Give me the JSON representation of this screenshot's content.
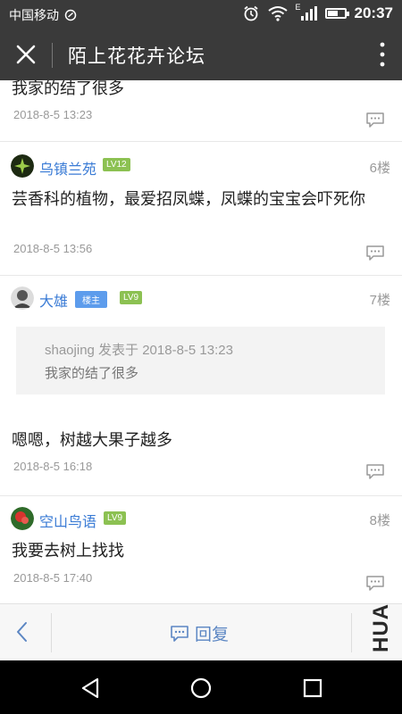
{
  "status_bar": {
    "carrier": "中国移动",
    "network_badge": "E",
    "time": "20:37",
    "battery_level": 0.6,
    "icons": [
      "notification-icon",
      "alarm-icon",
      "wifi-icon",
      "signal-icon",
      "battery-icon"
    ]
  },
  "title_bar": {
    "title": "陌上花花卉论坛",
    "icons": [
      "close-icon",
      "more-vert-icon"
    ]
  },
  "posts": [
    {
      "text": "我家的结了很多",
      "date": "2018-8-5 13:23"
    },
    {
      "user": "乌镇兰苑",
      "level": "LV12",
      "floor": "6楼",
      "text": "芸香科的植物，最爱招凤蝶，凤蝶的宝宝会吓死你",
      "date": "2018-8-5 13:56"
    },
    {
      "user": "大雄",
      "host_badge": "楼主",
      "level": "LV9",
      "floor": "7楼",
      "quote_header": "shaojing 发表于 2018-8-5 13:23",
      "quote_text": "我家的结了很多",
      "text": "嗯嗯，树越大果子越多",
      "date": "2018-8-5 16:18"
    },
    {
      "user": "空山鸟语",
      "level": "LV9",
      "floor": "8楼",
      "text": "我要去树上找找",
      "date": "2018-8-5 17:40"
    }
  ],
  "bottom_bar": {
    "reply_label": "回复",
    "watermark": "HUA"
  },
  "colors": {
    "bar_bg": "#3a3a3a",
    "username": "#3a7bd5",
    "level_badge": "#8cc152",
    "host_badge": "#5d9cec",
    "reply": "#5b86c3"
  }
}
